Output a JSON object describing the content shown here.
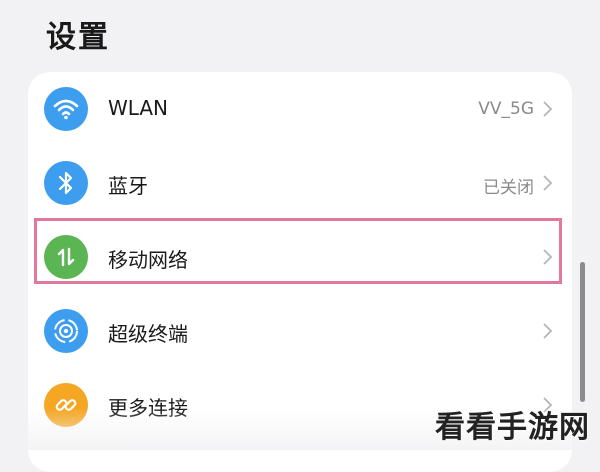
{
  "header": {
    "title": "设置"
  },
  "settings": {
    "items": [
      {
        "label": "WLAN",
        "value": "VV_5G",
        "icon": "wifi-icon",
        "color": "#3d9ef0"
      },
      {
        "label": "蓝牙",
        "value": "已关闭",
        "icon": "bluetooth-icon",
        "color": "#3d9ef0"
      },
      {
        "label": "移动网络",
        "value": "",
        "icon": "mobile-data-icon",
        "color": "#5ab552"
      },
      {
        "label": "超级终端",
        "value": "",
        "icon": "super-device-icon",
        "color": "#3d9ef0"
      },
      {
        "label": "更多连接",
        "value": "",
        "icon": "link-icon",
        "color": "#f5a623"
      }
    ]
  },
  "highlight": {
    "color": "#e0799b",
    "target": "移动网络"
  },
  "watermark": {
    "text": "看看手游网"
  }
}
